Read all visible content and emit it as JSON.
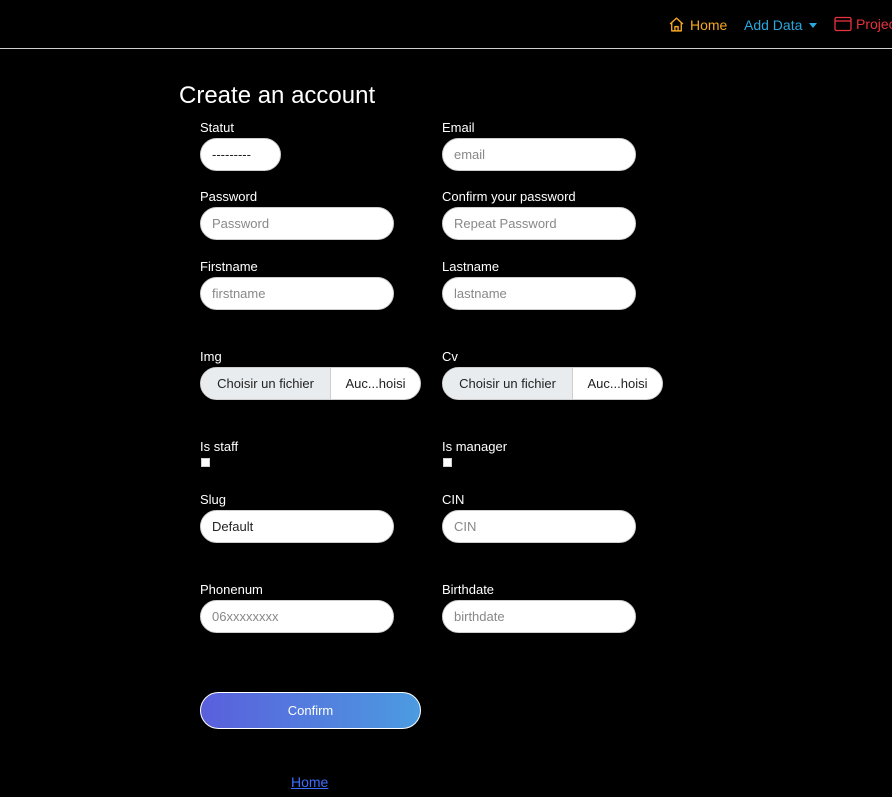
{
  "nav": {
    "home_label": "Home",
    "add_data_label": "Add Data",
    "projects_label": "Projects",
    "colors": {
      "home": "#f5a623",
      "add_data": "#29a8df",
      "projects": "#e8333e"
    },
    "icons": [
      "home-icon",
      "caret-down-icon",
      "window-icon"
    ]
  },
  "form": {
    "title": "Create an account",
    "statut": {
      "label": "Statut",
      "value": "---------"
    },
    "email": {
      "label": "Email",
      "placeholder": "email"
    },
    "password": {
      "label": "Password",
      "placeholder": "Password"
    },
    "confirm_password": {
      "label": "Confirm your password",
      "placeholder": "Repeat Password"
    },
    "firstname": {
      "label": "Firstname",
      "placeholder": "firstname"
    },
    "lastname": {
      "label": "Lastname",
      "placeholder": "lastname"
    },
    "img": {
      "label": "Img",
      "button": "Choisir un fichier",
      "file_text": "Auc...hoisi"
    },
    "cv": {
      "label": "Cv",
      "button": "Choisir un fichier",
      "file_text": "Auc...hoisi"
    },
    "is_staff": {
      "label": "Is staff"
    },
    "is_manager": {
      "label": "Is manager"
    },
    "slug": {
      "label": "Slug",
      "value": "Default"
    },
    "cin": {
      "label": "CIN",
      "placeholder": "CIN"
    },
    "phonenum": {
      "label": "Phonenum",
      "placeholder": "06xxxxxxxx"
    },
    "birthdate": {
      "label": "Birthdate",
      "placeholder": "birthdate"
    },
    "confirm_button": "Confirm",
    "home_link": "Home"
  }
}
